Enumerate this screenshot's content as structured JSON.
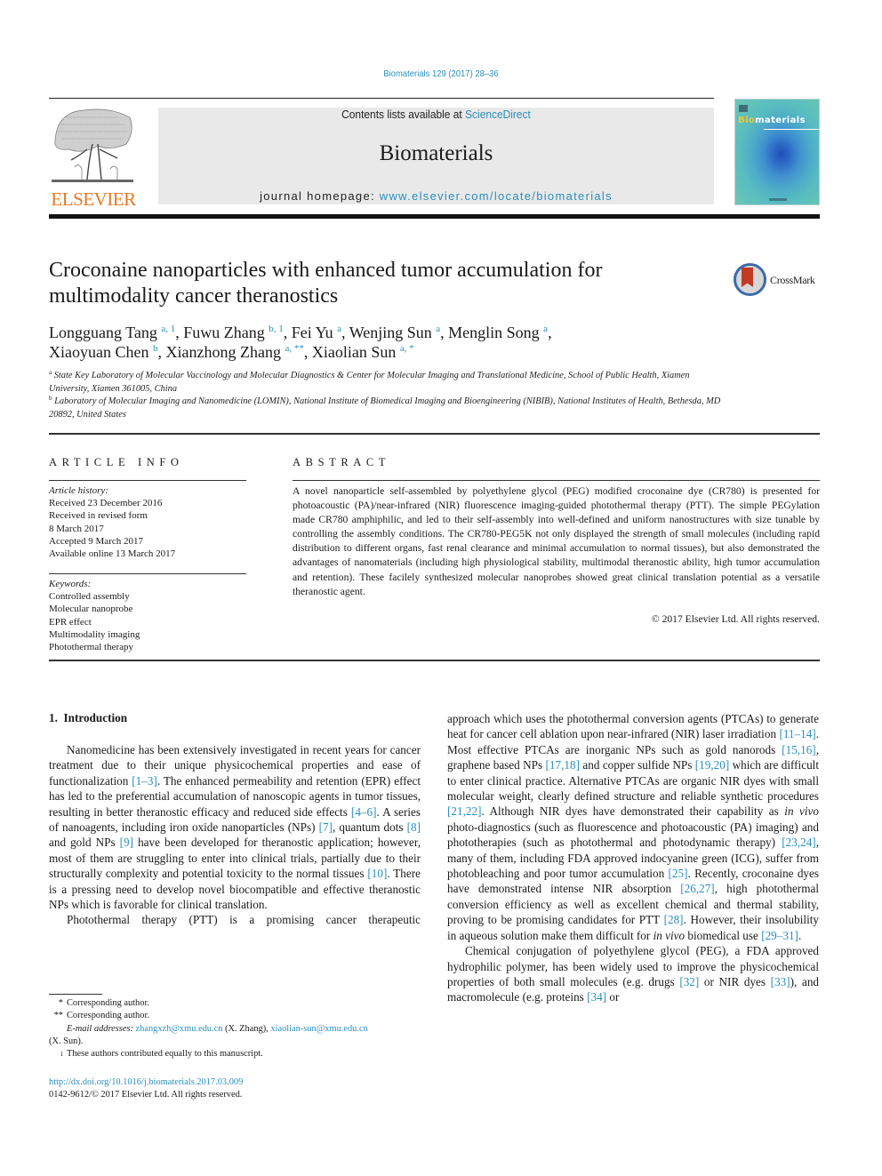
{
  "header": {
    "journal_ref": "Biomaterials 129 (2017) 28–36",
    "contents_prefix": "Contents lists available at ",
    "contents_link": "ScienceDirect",
    "journal_title": "Biomaterials",
    "homepage_prefix": "journal homepage: ",
    "homepage_link": "www.elsevier.com/locate/biomaterials",
    "publisher_logo_text": "ELSEVIER",
    "cover_title_highlight": "Bio",
    "cover_title_rest": "materials",
    "crossmark_label": "CrossMark",
    "colors": {
      "link": "#2a8fbd",
      "elsevier_orange": "#e87722",
      "header_box": "#e9e9e9"
    }
  },
  "article": {
    "title": "Croconaine nanoparticles with enhanced tumor accumulation for multimodality cancer theranostics",
    "authors": [
      {
        "name": "Longguang Tang",
        "sup": "a, 1",
        "sep": ", "
      },
      {
        "name": "Fuwu Zhang",
        "sup": "b, 1",
        "sep": ", "
      },
      {
        "name": "Fei Yu",
        "sup": "a",
        "sep": ", "
      },
      {
        "name": "Wenjing Sun",
        "sup": "a",
        "sep": ", "
      },
      {
        "name": "Menglin Song",
        "sup": "a",
        "sep": ","
      },
      {
        "name": "Xiaoyuan Chen",
        "sup": "b",
        "sep": ", "
      },
      {
        "name": "Xianzhong Zhang",
        "sup": "a, **",
        "sep": ", "
      },
      {
        "name": "Xiaolian Sun",
        "sup": "a, *",
        "sep": ""
      }
    ],
    "affiliations": [
      {
        "mark": "a",
        "text": "State Key Laboratory of Molecular Vaccinology and Molecular Diagnostics & Center for Molecular Imaging and Translational Medicine, School of Public Health, Xiamen University, Xiamen 361005, China"
      },
      {
        "mark": "b",
        "text": "Laboratory of Molecular Imaging and Nanomedicine (LOMIN), National Institute of Biomedical Imaging and Bioengineering (NIBIB), National Institutes of Health, Bethesda, MD 20892, United States"
      }
    ]
  },
  "article_info": {
    "heading": "ARTICLE INFO",
    "history_label": "Article history:",
    "history": [
      "Received 23 December 2016",
      "Received in revised form",
      "8 March 2017",
      "Accepted 9 March 2017",
      "Available online 13 March 2017"
    ],
    "keywords_label": "Keywords:",
    "keywords": [
      "Controlled assembly",
      "Molecular nanoprobe",
      "EPR effect",
      "Multimodality imaging",
      "Photothermal therapy"
    ]
  },
  "abstract": {
    "heading": "ABSTRACT",
    "text": "A novel nanoparticle self-assembled by polyethylene glycol (PEG) modified croconaine dye (CR780) is presented for photoacoustic (PA)/near-infrared (NIR) fluorescence imaging-guided photothermal therapy (PTT). The simple PEGylation made CR780 amphiphilic, and led to their self-assembly into well-defined and uniform nanostructures with size tunable by controlling the assembly conditions. The CR780-PEG5K not only displayed the strength of small molecules (including rapid distribution to different organs, fast renal clearance and minimal accumulation to normal tissues), but also demonstrated the advantages of nanomaterials (including high physiological stability, multimodal theranostic ability, high tumor accumulation and retention). These facilely synthesized molecular nanoprobes showed great clinical translation potential as a versatile theranostic agent.",
    "copyright": "© 2017 Elsevier Ltd. All rights reserved."
  },
  "introduction": {
    "heading": "1.  Introduction",
    "paragraphs": [
      [
        {
          "t": "Nanomedicine has been extensively investigated in recent years for cancer treatment due to their unique physicochemical properties and ease of functionalization "
        },
        {
          "ref": "[1–3]"
        },
        {
          "t": ". The enhanced permeability and retention (EPR) effect has led to the preferential accumulation of nanoscopic agents in tumor tissues, resulting in better theranostic efficacy and reduced side effects "
        },
        {
          "ref": "[4–6]"
        },
        {
          "t": ". A series of nanoagents, including iron oxide nanoparticles (NPs) "
        },
        {
          "ref": "[7]"
        },
        {
          "t": ", quantum dots "
        },
        {
          "ref": "[8]"
        },
        {
          "t": " and gold NPs "
        },
        {
          "ref": "[9]"
        },
        {
          "t": " have been developed for theranostic application; however, most of them are struggling to enter into clinical trials, partially due to their structurally complexity and potential toxicity to the normal tissues "
        },
        {
          "ref": "[10]"
        },
        {
          "t": ". There is a pressing need to develop novel biocompatible and effective theranostic NPs which is favorable for clinical translation."
        }
      ],
      [
        {
          "t": "Photothermal therapy (PTT) is a promising cancer therapeutic approach which uses the photothermal conversion agents (PTCAs) to generate heat for cancer cell ablation upon near-infrared (NIR) laser irradiation "
        },
        {
          "ref": "[11–14]"
        },
        {
          "t": ". Most effective PTCAs are inorganic NPs such as gold nanorods "
        },
        {
          "ref": "[15,16]"
        },
        {
          "t": ", graphene based NPs "
        },
        {
          "ref": "[17,18]"
        },
        {
          "t": " and copper sulfide NPs "
        },
        {
          "ref": "[19,20]"
        },
        {
          "t": " which are difficult to enter clinical practice. Alternative PTCAs are organic NIR dyes with small molecular weight, clearly defined structure and reliable synthetic procedures "
        },
        {
          "ref": "[21,22]"
        },
        {
          "t": ". Although NIR dyes have demonstrated their capability as "
        },
        {
          "i": "in vivo"
        },
        {
          "t": " photo-diagnostics (such as fluorescence and photoacoustic (PA) imaging) and phototherapies (such as photothermal and photodynamic therapy) "
        },
        {
          "ref": "[23,24]"
        },
        {
          "t": ", many of them, including FDA approved indocyanine green (ICG), suffer from photobleaching and poor tumor accumulation "
        },
        {
          "ref": "[25]"
        },
        {
          "t": ". Recently, croconaine dyes have demonstrated intense NIR absorption "
        },
        {
          "ref": "[26,27]"
        },
        {
          "t": ", high photothermal conversion efficiency as well as excellent chemical and thermal stability, proving to be promising candidates for PTT "
        },
        {
          "ref": "[28]"
        },
        {
          "t": ". However, their insolubility in aqueous solution make them difficult for "
        },
        {
          "i": "in vivo"
        },
        {
          "t": " biomedical use "
        },
        {
          "ref": "[29–31]"
        },
        {
          "t": "."
        }
      ],
      [
        {
          "t": "Chemical conjugation of polyethylene glycol (PEG), a FDA approved hydrophilic polymer, has been widely used to improve the physicochemical properties of both small molecules (e.g. drugs "
        },
        {
          "ref": "[32]"
        },
        {
          "t": " or NIR dyes "
        },
        {
          "ref": "[33]"
        },
        {
          "t": "), and macromolecule (e.g. proteins "
        },
        {
          "ref": "[34]"
        },
        {
          "t": " or"
        }
      ]
    ]
  },
  "footnotes": {
    "items": [
      {
        "mark": "*",
        "text": "Corresponding author."
      },
      {
        "mark": "**",
        "text": "Corresponding author."
      }
    ],
    "email_label": "E-mail addresses: ",
    "email1": "zhangxzh@xmu.edu.cn",
    "email1_owner": " (X. Zhang), ",
    "email2": "xiaolian-sun@xmu.edu.cn",
    "email2_owner": "(X. Sun).",
    "equal_mark": "1",
    "equal_text": "These authors contributed equally to this manuscript.",
    "doi": "http://dx.doi.org/10.1016/j.biomaterials.2017.03.009",
    "issn_line": "0142-9612/© 2017 Elsevier Ltd. All rights reserved."
  }
}
